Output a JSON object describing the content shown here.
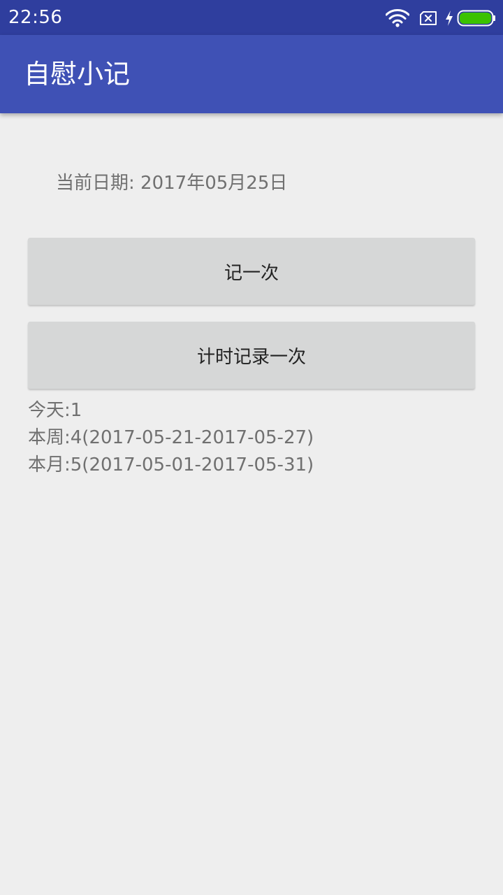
{
  "status_bar": {
    "time": "22:56",
    "icons": [
      "wifi-icon",
      "sim-missing-icon",
      "charging-bolt-icon",
      "battery-icon"
    ],
    "battery_color": "#3bc200"
  },
  "app_bar": {
    "title": "自慰小记",
    "color": "#3f51b5"
  },
  "main": {
    "current_date": "当前日期: 2017年05月25日",
    "record_button_label": "记一次",
    "timer_button_label": "计时记录一次",
    "stats": {
      "today": "今天:1",
      "week": "本周:4(2017-05-21-2017-05-27)",
      "month": "本月:5(2017-05-01-2017-05-31)"
    }
  }
}
